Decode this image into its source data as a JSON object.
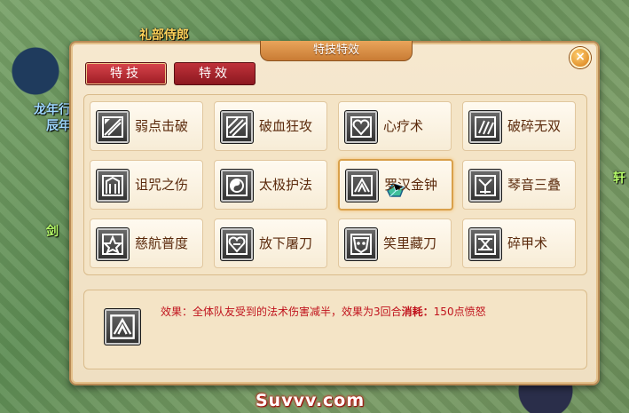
{
  "scene": {
    "npc_names": [
      "礼部侍郎",
      "龙年行",
      "辰年",
      "剑",
      "轩"
    ]
  },
  "window": {
    "title": "特技特效",
    "close_label": "×",
    "tabs": [
      {
        "label": "特技",
        "active": true
      },
      {
        "label": "特效",
        "active": false
      }
    ]
  },
  "skills": [
    {
      "name": "弱点击破",
      "icon": "broken-diagonal-icon"
    },
    {
      "name": "破血狂攻",
      "icon": "slash-marks-icon"
    },
    {
      "name": "心疗术",
      "icon": "heart-icon"
    },
    {
      "name": "破碎无双",
      "icon": "shatter-icon"
    },
    {
      "name": "诅咒之伤",
      "icon": "curse-icon"
    },
    {
      "name": "太极护法",
      "icon": "yin-yang-icon"
    },
    {
      "name": "罗汉金钟",
      "icon": "bell-icon",
      "selected": true
    },
    {
      "name": "琴音三叠",
      "icon": "lute-icon"
    },
    {
      "name": "慈航普度",
      "icon": "lotus-icon"
    },
    {
      "name": "放下屠刀",
      "icon": "heart-knot-icon"
    },
    {
      "name": "笑里藏刀",
      "icon": "mask-icon"
    },
    {
      "name": "碎甲术",
      "icon": "armor-break-icon"
    }
  ],
  "effect": {
    "icon": "bell-icon",
    "label": "效果：",
    "description": "全体队友受到的法术伤害减半，效果为3回合",
    "cost_label": "消耗：",
    "cost_value": "150点愤怒"
  },
  "watermark": "Suvvv.com"
}
